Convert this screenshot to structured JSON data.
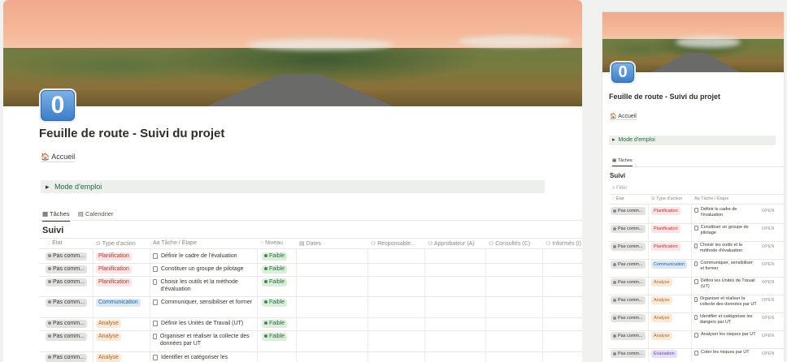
{
  "page": {
    "icon_glyph": "0",
    "title": "Feuille de route - Suivi du projet",
    "home_link": "🏠 Accueil",
    "callout": "Mode d'emploi",
    "callout_toggle": "▸"
  },
  "tabs": [
    {
      "label": "Tâches",
      "icon": "table-icon"
    },
    {
      "label": "Calendrier",
      "icon": "calendar-icon"
    }
  ],
  "section_title": "Suivi",
  "columns": [
    {
      "label": "État",
      "icon": "status-icon"
    },
    {
      "label": "Type d'action",
      "icon": "select-icon"
    },
    {
      "label": "Aa Tâche / Étape",
      "icon": "title-icon"
    },
    {
      "label": "Niveau",
      "icon": "status-icon"
    },
    {
      "label": "Dates",
      "icon": "calendar-icon"
    },
    {
      "label": "Responsable...",
      "icon": "person-icon"
    },
    {
      "label": "Approbateur (A)",
      "icon": "person-icon"
    },
    {
      "label": "Consultés (C)",
      "icon": "person-icon"
    },
    {
      "label": "Informés (I)",
      "icon": "person-icon"
    }
  ],
  "rows": [
    {
      "status": "Pas comm...",
      "type": "Planification",
      "type_class": "t-plan",
      "task": "Définir le cadre de l'évaluation",
      "level": "Faible"
    },
    {
      "status": "Pas comm...",
      "type": "Planification",
      "type_class": "t-plan",
      "task": "Constituer un groupe de pilotage",
      "level": "Faible"
    },
    {
      "status": "Pas comm...",
      "type": "Planification",
      "type_class": "t-plan",
      "task": "Choisir les outils et la méthode d'évaluation",
      "level": "Faible"
    },
    {
      "status": "Pas comm...",
      "type": "Communication",
      "type_class": "t-comm",
      "task": "Communiquer, sensibiliser et former",
      "level": "Faible"
    },
    {
      "status": "Pas comm...",
      "type": "Analyse",
      "type_class": "t-ana",
      "task": "Définir les Unités de Travail (UT)",
      "level": "Faible"
    },
    {
      "status": "Pas comm...",
      "type": "Analyse",
      "type_class": "t-ana",
      "task": "Organiser et réaliser la collecte des données par UT",
      "level": "Faible"
    },
    {
      "status": "Pas comm...",
      "type": "Analyse",
      "type_class": "t-ana",
      "task": "Identifier et catégoriser les",
      "level": ""
    }
  ],
  "side": {
    "title": "Feuille de route - Suivi du projet",
    "home_link": "🏠 Accueil",
    "callout": "Mode d'emploi",
    "tab": "Tâches",
    "section_title": "Suivi",
    "filter": "Filter",
    "columns": [
      "État",
      "Type d'action",
      "Aa Tâche / Étape"
    ],
    "open_label": "OPEN",
    "rows": [
      {
        "status": "Pas comm...",
        "type": "Planification",
        "type_class": "t-plan",
        "task": "Définir le cadre de l'évaluation"
      },
      {
        "status": "Pas comm...",
        "type": "Planification",
        "type_class": "t-plan",
        "task": "Constituer un groupe de pilotage"
      },
      {
        "status": "Pas comm...",
        "type": "Planification",
        "type_class": "t-plan",
        "task": "Choisir les outils et la méthode d'évaluation"
      },
      {
        "status": "Pas comm...",
        "type": "Communication",
        "type_class": "t-comm",
        "task": "Communiquer, sensibiliser et former"
      },
      {
        "status": "Pas comm...",
        "type": "Analyse",
        "type_class": "t-ana",
        "task": "Définir les Unités de Travail (UT)"
      },
      {
        "status": "Pas comm...",
        "type": "Analyse",
        "type_class": "t-ana",
        "task": "Organiser et réaliser la collecte des données par UT"
      },
      {
        "status": "Pas comm...",
        "type": "Analyse",
        "type_class": "t-ana",
        "task": "Identifier et catégoriser les dangers par UT"
      },
      {
        "status": "Pas comm...",
        "type": "Analyse",
        "type_class": "t-ana",
        "task": "Analyser les risques par UT"
      },
      {
        "status": "Pas comm...",
        "type": "Evaluation",
        "type_class": "t-eval",
        "task": "Coter les risques par UT"
      }
    ]
  },
  "colors": {
    "accent_green": "#1f6a3b",
    "icon_blue": "#3a7dc9"
  }
}
